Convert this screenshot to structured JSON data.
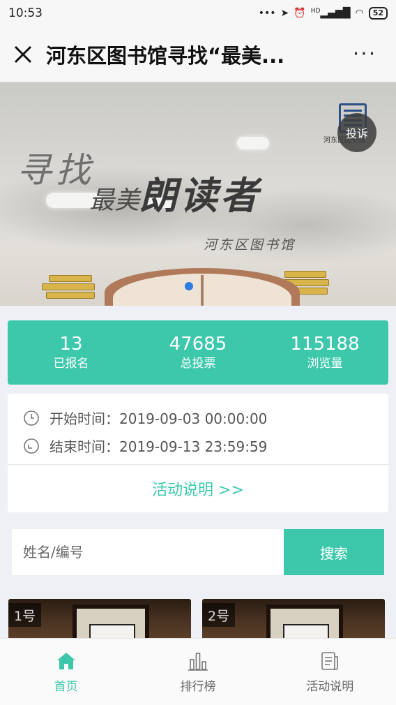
{
  "status_bar": {
    "time": "10:53",
    "signal_label": "HD",
    "battery": "52"
  },
  "nav": {
    "title": "河东区图书馆寻找“最美...",
    "more": "···"
  },
  "banner": {
    "line1": "寻找",
    "line2_small": "最美",
    "line2_big": "朗读者",
    "line3": "河东区图书馆",
    "logo_text": "河东区图书馆",
    "complaint": "投诉"
  },
  "stats": [
    {
      "value": "13",
      "label": "已报名"
    },
    {
      "value": "47685",
      "label": "总投票"
    },
    {
      "value": "115188",
      "label": "浏览量"
    }
  ],
  "times": {
    "start": "开始时间：2019-09-03 00:00:00",
    "end": "结束时间：2019-09-13 23:59:59"
  },
  "rules_link": "活动说明 >>",
  "search": {
    "placeholder": "姓名/编号",
    "button": "搜索"
  },
  "cards": [
    {
      "badge": "1号"
    },
    {
      "badge": "2号"
    }
  ],
  "tabs": [
    {
      "label": "首页",
      "icon": "home-icon",
      "active": true
    },
    {
      "label": "排行榜",
      "icon": "bar-chart-icon",
      "active": false
    },
    {
      "label": "活动说明",
      "icon": "document-icon",
      "active": false
    }
  ],
  "colors": {
    "accent": "#3dc8ac",
    "page_bg": "#eef0f6",
    "dot": "#2d7de0"
  }
}
